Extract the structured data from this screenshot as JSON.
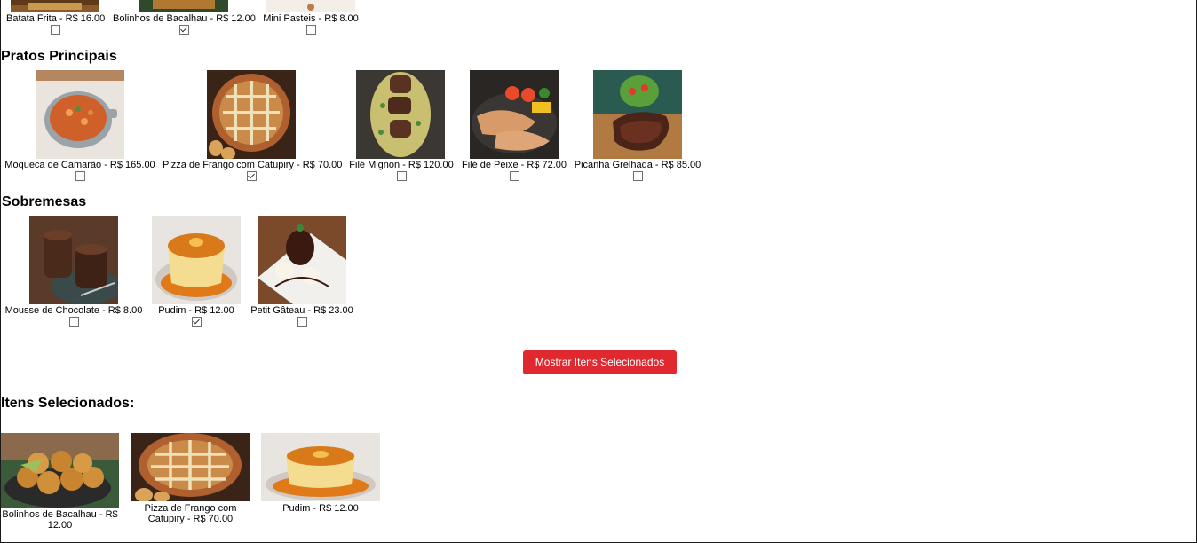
{
  "top_row": {
    "items": [
      {
        "label": "Batata Frita - R$ 16.00",
        "checked": false
      },
      {
        "label": "Bolinhos de Bacalhau - R$ 12.00",
        "checked": true
      },
      {
        "label": "Mini Pasteis - R$ 8.00",
        "checked": false
      }
    ]
  },
  "pratos": {
    "title": "Pratos Principais",
    "items": [
      {
        "label": "Moqueca de Camarão - R$ 165.00",
        "checked": false
      },
      {
        "label": "Pizza de Frango com Catupiry - R$ 70.00",
        "checked": true
      },
      {
        "label": "Filé Mignon - R$ 120.00",
        "checked": false
      },
      {
        "label": "Filé de Peixe - R$ 72.00",
        "checked": false
      },
      {
        "label": "Picanha Grelhada - R$ 85.00",
        "checked": false
      }
    ]
  },
  "sobremesas": {
    "title": "Sobremesas",
    "items": [
      {
        "label": "Mousse de Chocolate - R$ 8.00",
        "checked": false
      },
      {
        "label": "Pudim - R$ 12.00",
        "checked": true
      },
      {
        "label": "Petit Gâteau - R$ 23.00",
        "checked": false
      }
    ]
  },
  "button": {
    "label": "Mostrar Itens Selecionados",
    "color": "#e0282f"
  },
  "selected": {
    "title": "Itens Selecionados:",
    "items": [
      {
        "label": "Bolinhos de Bacalhau - R$ 12.00"
      },
      {
        "label": "Pizza de Frango com Catupiry - R$ 70.00"
      },
      {
        "label": "Pudim - R$ 12.00"
      }
    ]
  }
}
